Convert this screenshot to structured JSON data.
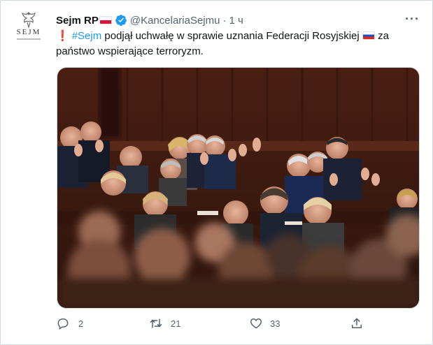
{
  "tweet": {
    "author_name": "Sejm RP",
    "handle": "@KancelariaSejmu",
    "separator": "·",
    "time": "1 ч",
    "text_parts": {
      "exclamation": "❗",
      "hashtag": "#Sejm",
      "body": " podjął uchwałę w sprawie uznania Federacji Rosyjskiej",
      "tail": " za państwo wspierające terroryzm."
    },
    "avatar_text": "SEJM",
    "more_icon": "more-dots-icon",
    "photo_description_icon": "photo"
  },
  "actions": {
    "reply_count": "2",
    "retweet_count": "21",
    "like_count": "33",
    "icons": [
      "reply-icon",
      "retweet-icon",
      "like-icon",
      "share-icon"
    ]
  },
  "colors": {
    "accent": "#1d9bf0",
    "muted": "#536471",
    "text": "#0f1419",
    "border": "#cfd9de"
  }
}
